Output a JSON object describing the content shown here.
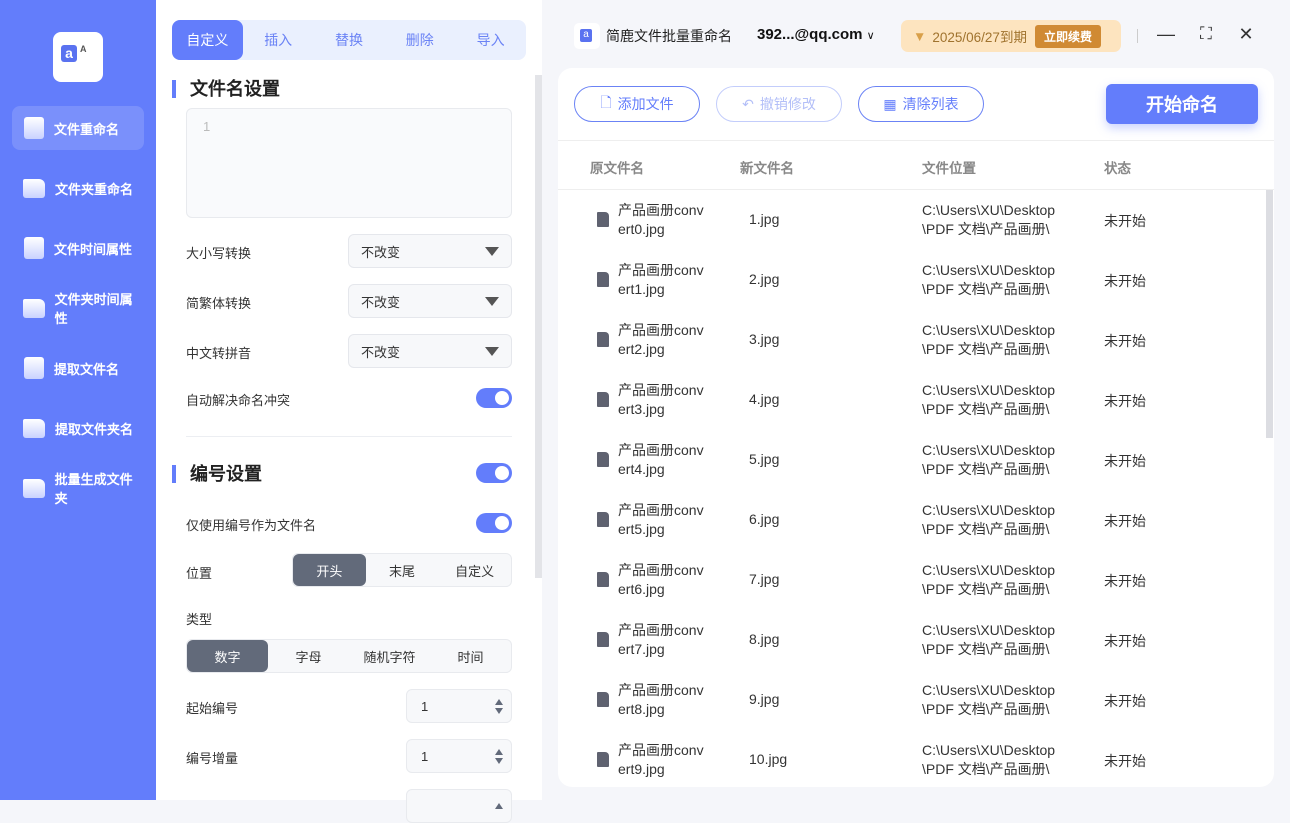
{
  "sidebar": {
    "items": [
      {
        "label": "文件重命名",
        "icon": "file-icon"
      },
      {
        "label": "文件夹重命名",
        "icon": "folder-icon"
      },
      {
        "label": "文件时间属性",
        "icon": "file-clock-icon"
      },
      {
        "label": "文件夹时间属性",
        "icon": "folder-clock-icon"
      },
      {
        "label": "提取文件名",
        "icon": "file-upload-icon"
      },
      {
        "label": "提取文件夹名",
        "icon": "folder-up-icon"
      },
      {
        "label": "批量生成文件夹",
        "icon": "folder-add-icon"
      }
    ]
  },
  "tabs": [
    "自定义",
    "插入",
    "替换",
    "删除",
    "导入"
  ],
  "filename_settings": {
    "title": "文件名设置",
    "editor_line": "1",
    "case_label": "大小写转换",
    "case_value": "不改变",
    "trad_label": "简繁体转换",
    "trad_value": "不改变",
    "pinyin_label": "中文转拼音",
    "pinyin_value": "不改变",
    "conflict_label": "自动解决命名冲突",
    "conflict_on": true
  },
  "numbering": {
    "title": "编号设置",
    "enabled": true,
    "only_number_label": "仅使用编号作为文件名",
    "only_number_on": true,
    "position_label": "位置",
    "positions": [
      "开头",
      "末尾",
      "自定义"
    ],
    "type_label": "类型",
    "types": [
      "数字",
      "字母",
      "随机字符",
      "时间"
    ],
    "start_label": "起始编号",
    "start_value": "1",
    "step_label": "编号增量",
    "step_value": "1"
  },
  "header": {
    "app_name": "简鹿文件批量重命名",
    "account": "392...@qq.com",
    "expiry": "2025/06/27到期",
    "renew": "立即续费"
  },
  "toolbar": {
    "add": "添加文件",
    "undo": "撤销修改",
    "clear": "清除列表",
    "start": "开始命名"
  },
  "table": {
    "columns": [
      "原文件名",
      "新文件名",
      "文件位置",
      "状态"
    ],
    "rows": [
      {
        "orig1": "产品画册conv",
        "orig2": "ert0.jpg",
        "new": "1.jpg",
        "loc1": "C:\\Users\\XU\\Desktop",
        "loc2": "\\PDF 文档\\产品画册\\",
        "status": "未开始"
      },
      {
        "orig1": "产品画册conv",
        "orig2": "ert1.jpg",
        "new": "2.jpg",
        "loc1": "C:\\Users\\XU\\Desktop",
        "loc2": "\\PDF 文档\\产品画册\\",
        "status": "未开始"
      },
      {
        "orig1": "产品画册conv",
        "orig2": "ert2.jpg",
        "new": "3.jpg",
        "loc1": "C:\\Users\\XU\\Desktop",
        "loc2": "\\PDF 文档\\产品画册\\",
        "status": "未开始"
      },
      {
        "orig1": "产品画册conv",
        "orig2": "ert3.jpg",
        "new": "4.jpg",
        "loc1": "C:\\Users\\XU\\Desktop",
        "loc2": "\\PDF 文档\\产品画册\\",
        "status": "未开始"
      },
      {
        "orig1": "产品画册conv",
        "orig2": "ert4.jpg",
        "new": "5.jpg",
        "loc1": "C:\\Users\\XU\\Desktop",
        "loc2": "\\PDF 文档\\产品画册\\",
        "status": "未开始"
      },
      {
        "orig1": "产品画册conv",
        "orig2": "ert5.jpg",
        "new": "6.jpg",
        "loc1": "C:\\Users\\XU\\Desktop",
        "loc2": "\\PDF 文档\\产品画册\\",
        "status": "未开始"
      },
      {
        "orig1": "产品画册conv",
        "orig2": "ert6.jpg",
        "new": "7.jpg",
        "loc1": "C:\\Users\\XU\\Desktop",
        "loc2": "\\PDF 文档\\产品画册\\",
        "status": "未开始"
      },
      {
        "orig1": "产品画册conv",
        "orig2": "ert7.jpg",
        "new": "8.jpg",
        "loc1": "C:\\Users\\XU\\Desktop",
        "loc2": "\\PDF 文档\\产品画册\\",
        "status": "未开始"
      },
      {
        "orig1": "产品画册conv",
        "orig2": "ert8.jpg",
        "new": "9.jpg",
        "loc1": "C:\\Users\\XU\\Desktop",
        "loc2": "\\PDF 文档\\产品画册\\",
        "status": "未开始"
      },
      {
        "orig1": "产品画册conv",
        "orig2": "ert9.jpg",
        "new": "10.jpg",
        "loc1": "C:\\Users\\XU\\Desktop",
        "loc2": "\\PDF 文档\\产品画册\\",
        "status": "未开始"
      }
    ]
  }
}
